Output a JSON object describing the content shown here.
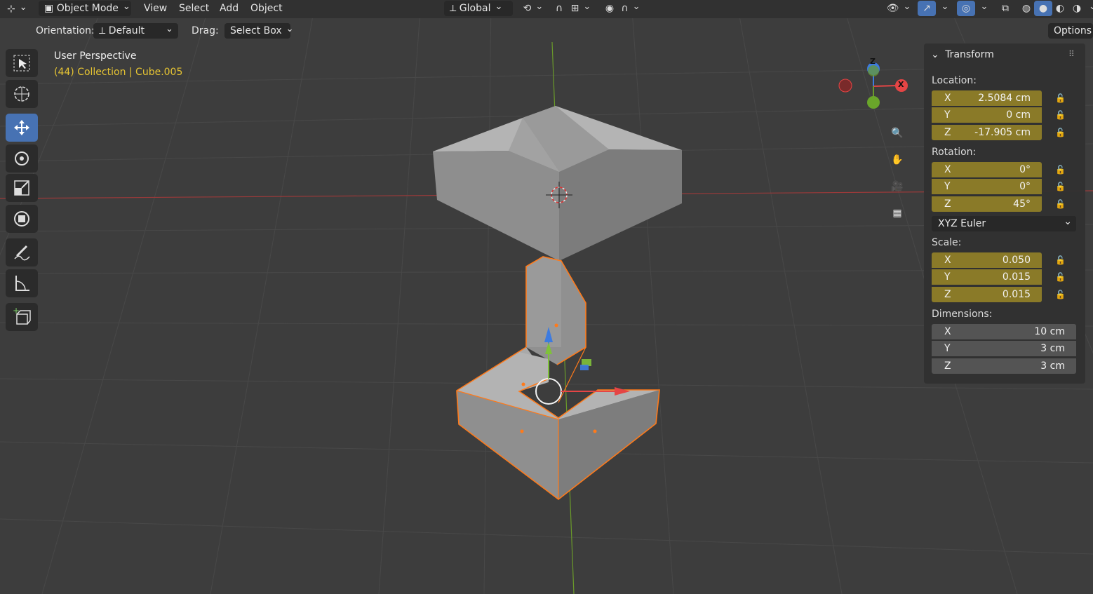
{
  "header": {
    "editor_type_icon": "axis-icon",
    "mode": "Object Mode",
    "menus": [
      "View",
      "Select",
      "Add",
      "Object"
    ],
    "transform_orientation": "Global",
    "options_label": "Options"
  },
  "tool_settings": {
    "orientation_label": "Orientation:",
    "orientation_value": "Default",
    "drag_label": "Drag:",
    "drag_value": "Select Box"
  },
  "viewport": {
    "view_name": "User Perspective",
    "collection_info": "(44) Collection | Cube.005",
    "gizmo_axes": [
      "Z",
      "X"
    ]
  },
  "toolbar": {
    "tools": [
      "select-box",
      "cursor",
      "move",
      "rotate",
      "scale",
      "transform",
      "annotate",
      "measure",
      "add-cube"
    ],
    "active": "move"
  },
  "n_panel": {
    "title": "Transform",
    "location_label": "Location:",
    "location": [
      {
        "axis": "X",
        "value": "2.5084 cm"
      },
      {
        "axis": "Y",
        "value": "0 cm"
      },
      {
        "axis": "Z",
        "value": "-17.905 cm"
      }
    ],
    "rotation_label": "Rotation:",
    "rotation": [
      {
        "axis": "X",
        "value": "0°"
      },
      {
        "axis": "Y",
        "value": "0°"
      },
      {
        "axis": "Z",
        "value": "45°"
      }
    ],
    "rotation_mode": "XYZ Euler",
    "scale_label": "Scale:",
    "scale": [
      {
        "axis": "X",
        "value": "0.050"
      },
      {
        "axis": "Y",
        "value": "0.015"
      },
      {
        "axis": "Z",
        "value": "0.015"
      }
    ],
    "dimensions_label": "Dimensions:",
    "dimensions": [
      {
        "axis": "X",
        "value": "10 cm"
      },
      {
        "axis": "Y",
        "value": "3 cm"
      },
      {
        "axis": "Z",
        "value": "3 cm"
      }
    ]
  },
  "colors": {
    "accent": "#4772b3",
    "field_active": "#8a7a28",
    "selection_outline": "#ff7a1a",
    "text_highlight": "#e6c433"
  }
}
